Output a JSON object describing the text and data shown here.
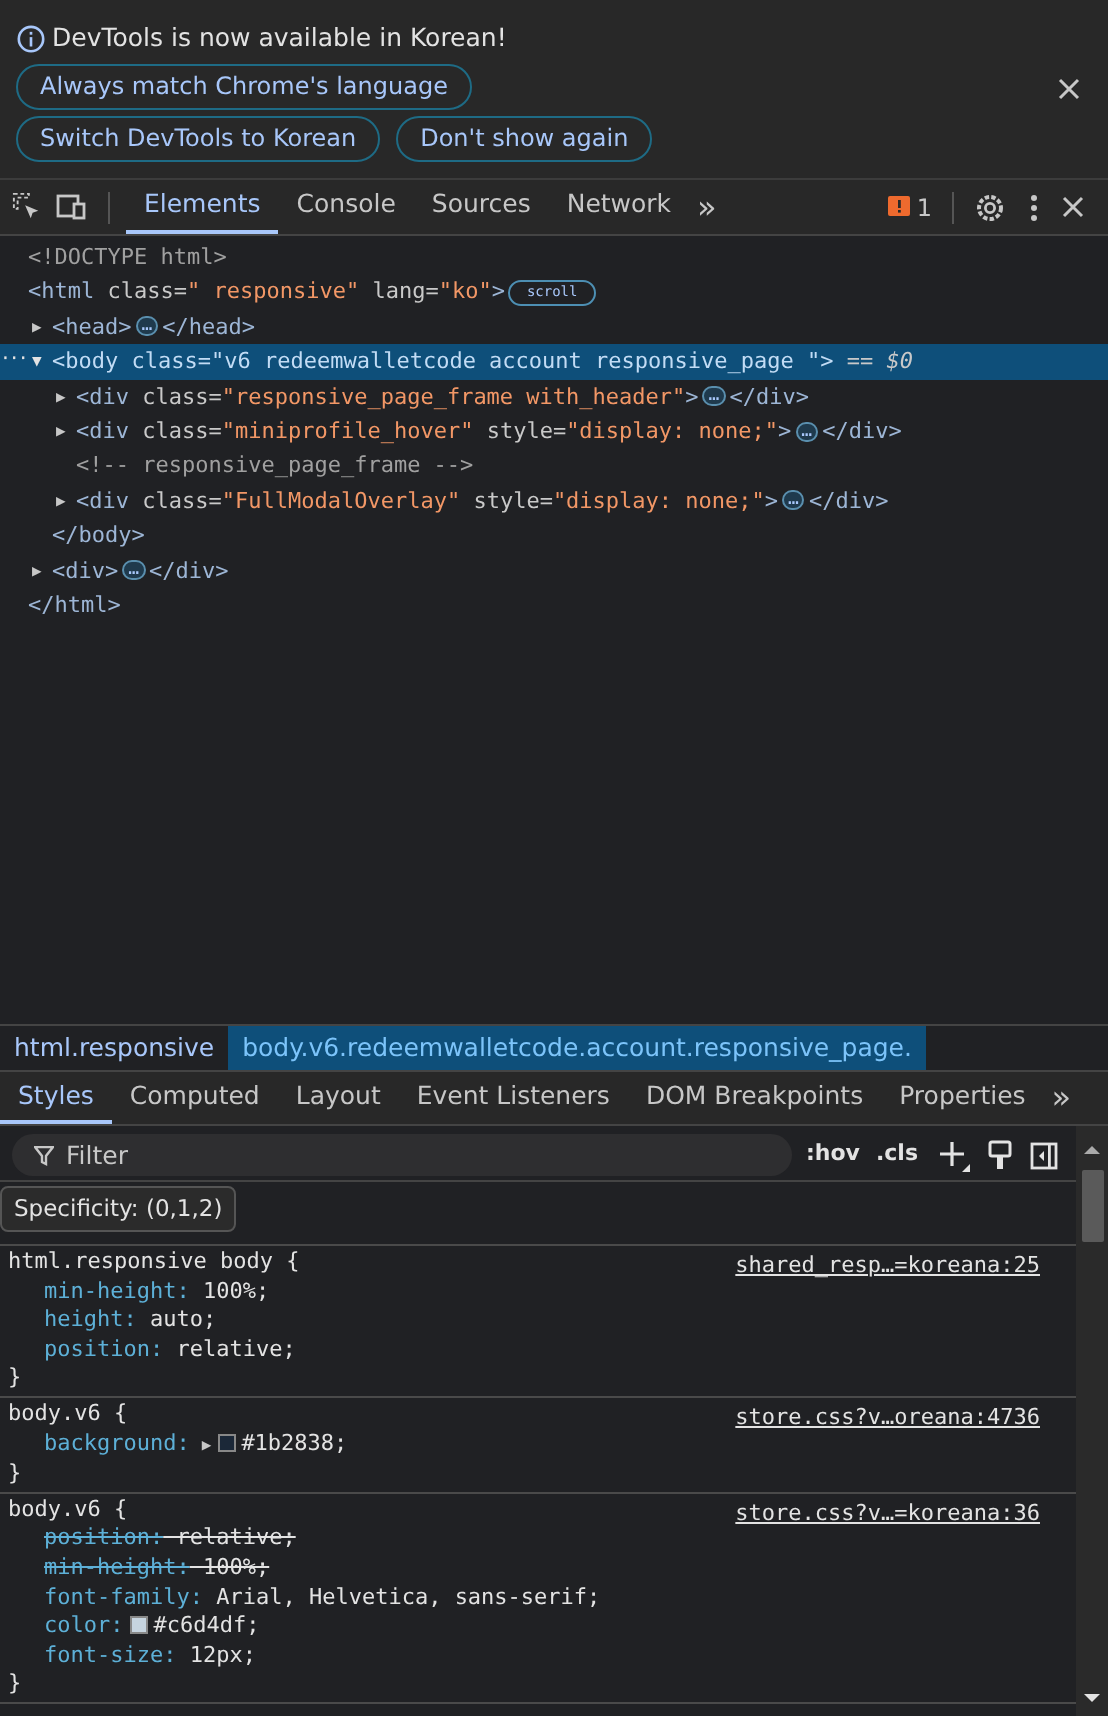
{
  "infobar": {
    "message": "DevTools is now available in Korean!",
    "buttons": [
      "Always match Chrome's language",
      "Switch DevTools to Korean",
      "Don't show again"
    ]
  },
  "tabs": [
    {
      "label": "Elements",
      "selected": true
    },
    {
      "label": "Console",
      "selected": false
    },
    {
      "label": "Sources",
      "selected": false
    },
    {
      "label": "Network",
      "selected": false
    }
  ],
  "more_tabs": "»",
  "issues_count": "1",
  "dom_tree": [
    {
      "parts": [
        {
          "kind": "doctype",
          "text": "<!DOCTYPE html>"
        }
      ]
    },
    {
      "parts": [
        {
          "kind": "tag",
          "text": "<html"
        },
        {
          "kind": "attr",
          "text": " class="
        },
        {
          "kind": "value",
          "text": "\" responsive\""
        },
        {
          "kind": "attr",
          "text": " lang="
        },
        {
          "kind": "value",
          "text": "\"ko\""
        },
        {
          "kind": "tag",
          "text": ">"
        },
        {
          "kind": "badge",
          "text": "scroll"
        }
      ],
      "children": [
        {
          "toggle": "▶",
          "expanded": false,
          "parts": [
            {
              "kind": "tag",
              "text": "<head>"
            },
            {
              "kind": "ellipsis",
              "text": "…"
            },
            {
              "kind": "tag",
              "text": "</head>"
            }
          ]
        },
        {
          "toggle": "▼",
          "expanded": true,
          "selected": true,
          "gutter": "···",
          "parts": [
            {
              "kind": "tag",
              "text": "<body"
            },
            {
              "kind": "attr",
              "text": " class="
            },
            {
              "kind": "value",
              "text": "\"v6 redeemwalletcode account responsive_page \""
            },
            {
              "kind": "tag",
              "text": ">"
            },
            {
              "kind": "marker",
              "text": " == $0"
            }
          ],
          "children": [
            {
              "toggle": "▶",
              "expanded": false,
              "parts": [
                {
                  "kind": "tag",
                  "text": "<div"
                },
                {
                  "kind": "attr",
                  "text": " class="
                },
                {
                  "kind": "value",
                  "text": "\"responsive_page_frame with_header\""
                },
                {
                  "kind": "tag",
                  "text": ">"
                },
                {
                  "kind": "ellipsis",
                  "text": "…"
                },
                {
                  "kind": "tag",
                  "text": "</div>"
                }
              ]
            },
            {
              "toggle": "▶",
              "expanded": false,
              "parts": [
                {
                  "kind": "tag",
                  "text": "<div"
                },
                {
                  "kind": "attr",
                  "text": " class="
                },
                {
                  "kind": "value",
                  "text": "\"miniprofile_hover\""
                },
                {
                  "kind": "attr",
                  "text": " style="
                },
                {
                  "kind": "value",
                  "text": "\"display: none;\""
                },
                {
                  "kind": "tag",
                  "text": ">"
                },
                {
                  "kind": "ellipsis",
                  "text": "…"
                },
                {
                  "kind": "tag",
                  "text": "</div>"
                }
              ]
            },
            {
              "parts": [
                {
                  "kind": "comment",
                  "text": "<!-- responsive_page_frame -->"
                }
              ]
            },
            {
              "toggle": "▶",
              "expanded": false,
              "parts": [
                {
                  "kind": "tag",
                  "text": "<div"
                },
                {
                  "kind": "attr",
                  "text": " class="
                },
                {
                  "kind": "value",
                  "text": "\"FullModalOverlay\""
                },
                {
                  "kind": "attr",
                  "text": " style="
                },
                {
                  "kind": "value",
                  "text": "\"display: none;\""
                },
                {
                  "kind": "tag",
                  "text": ">"
                },
                {
                  "kind": "ellipsis",
                  "text": "…"
                },
                {
                  "kind": "tag",
                  "text": "</div>"
                }
              ]
            }
          ],
          "closing": [
            {
              "kind": "tag",
              "text": "</body>"
            }
          ]
        },
        {
          "toggle": "▶",
          "expanded": false,
          "parts": [
            {
              "kind": "tag",
              "text": "<div>"
            },
            {
              "kind": "ellipsis",
              "text": "…"
            },
            {
              "kind": "tag",
              "text": "</div>"
            }
          ]
        }
      ],
      "closing": [
        {
          "kind": "tag",
          "text": "</html>"
        }
      ]
    }
  ],
  "breadcrumbs": [
    {
      "label": "html.responsive",
      "selected": false
    },
    {
      "label": "body.v6.redeemwalletcode.account.responsive_page.",
      "selected": true
    }
  ],
  "sub_tabs": [
    {
      "label": "Styles",
      "selected": true
    },
    {
      "label": "Computed",
      "selected": false
    },
    {
      "label": "Layout",
      "selected": false
    },
    {
      "label": "Event Listeners",
      "selected": false
    },
    {
      "label": "DOM Breakpoints",
      "selected": false
    },
    {
      "label": "Properties",
      "selected": false
    }
  ],
  "more_sub_tabs": "»",
  "filter": {
    "placeholder": "Filter"
  },
  "style_buttons": [
    ":hov",
    ".cls"
  ],
  "tooltip": "Specificity: (0,1,2)",
  "declaration_separator": ":",
  "rules": [
    {
      "selector": "html.responsive body {",
      "source": "shared_resp…=koreana:25",
      "declarations": [
        {
          "property": "min-height",
          "value": "100%;"
        },
        {
          "property": "height",
          "value": "auto;"
        },
        {
          "property": "position",
          "value": "relative;"
        }
      ],
      "close": "}"
    },
    {
      "selector": "body.v6 {",
      "source": "store.css?v…oreana:4736",
      "declarations": [
        {
          "property": "background",
          "value": "#1b2838;",
          "expand_toggle": "▶",
          "color": "#1b2838"
        }
      ],
      "close": "}"
    },
    {
      "selector": "body.v6 {",
      "source": "store.css?v…=koreana:36",
      "declarations": [
        {
          "property": "position",
          "value": "relative;",
          "struck": true
        },
        {
          "property": "min-height",
          "value": "100%;",
          "struck": true
        },
        {
          "property": "font-family",
          "value": "Arial, Helvetica, sans-serif;"
        },
        {
          "property": "color",
          "value": "#c6d4df;",
          "color": "#c6d4df"
        },
        {
          "property": "font-size",
          "value": "12px;"
        }
      ],
      "close": "}"
    }
  ]
}
